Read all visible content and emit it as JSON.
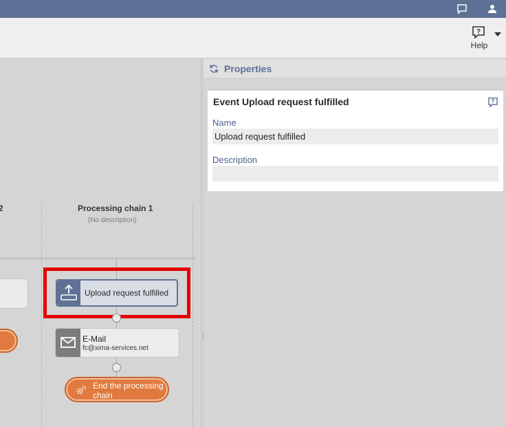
{
  "toolbar": {
    "help_label": "Help"
  },
  "properties": {
    "title": "Properties",
    "card_title": "Event Upload request fulfilled",
    "name_label": "Name",
    "name_value": "Upload request fulfilled",
    "description_label": "Description",
    "description_value": ""
  },
  "lanes": {
    "left_partial_title": "2",
    "chain_title": "Processing chain 1",
    "chain_description": "(No description)"
  },
  "nodes": {
    "upload_label": "Upload request fulfilled",
    "email_label": "E-Mail",
    "email_address": "fc@xima-services.net",
    "end_label": "End the processing chain"
  },
  "colors": {
    "topbar": "#5e7196",
    "accent": "#5e7196",
    "end_node": "#e07a3f",
    "highlight": "#e60000"
  },
  "icons": [
    "chat-icon",
    "user-icon",
    "help-icon",
    "refresh-icon",
    "upload-icon",
    "mail-icon",
    "gears-icon"
  ]
}
